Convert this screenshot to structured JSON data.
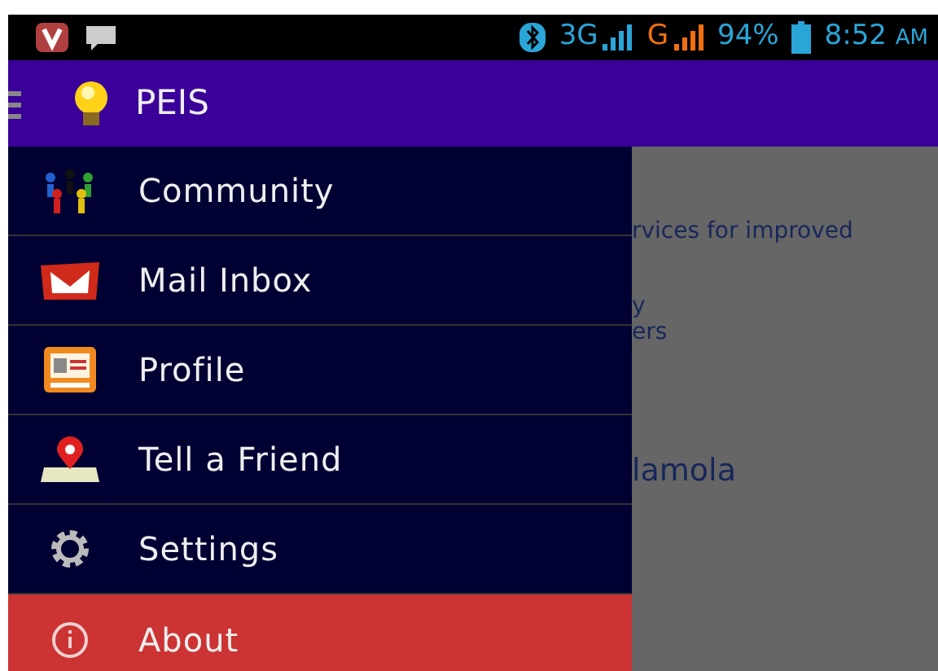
{
  "status_bar": {
    "network_1": "3G",
    "network_2": "G",
    "battery": "94%",
    "time": "8:52",
    "period": "AM"
  },
  "app_bar": {
    "title": "PEIS"
  },
  "drawer": {
    "items": [
      {
        "label": "Community",
        "kind": "community",
        "selected": false
      },
      {
        "label": "Mail Inbox",
        "kind": "mail",
        "selected": false
      },
      {
        "label": "Profile",
        "kind": "profile",
        "selected": false
      },
      {
        "label": "Tell a Friend",
        "kind": "map",
        "selected": false
      },
      {
        "label": "Settings",
        "kind": "settings",
        "selected": false
      },
      {
        "label": "About",
        "kind": "info",
        "selected": true
      }
    ]
  },
  "background": {
    "texts": [
      {
        "text": "rvices for improved",
        "kind": "small"
      },
      {
        "text": "y",
        "kind": "small"
      },
      {
        "text": "ers",
        "kind": "small"
      },
      {
        "text": "lamola",
        "kind": "large"
      }
    ]
  }
}
